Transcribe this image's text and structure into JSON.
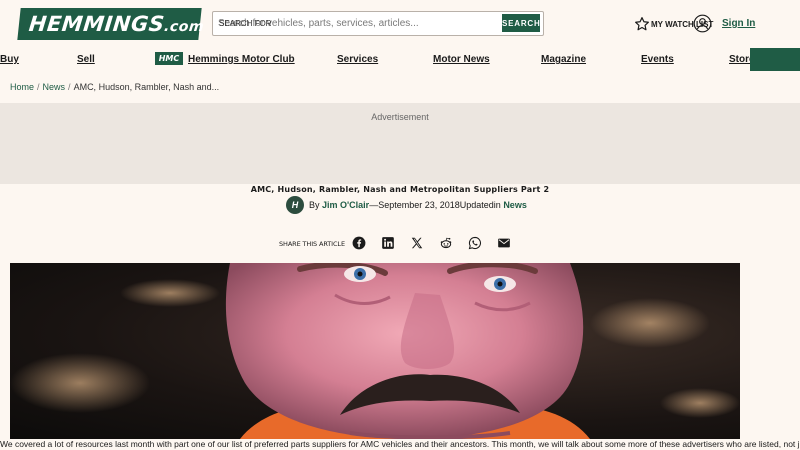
{
  "header": {
    "logo_text": "HEMMINGS",
    "logo_suffix": ".com",
    "search_label": "SEARCH FOR",
    "search_placeholder": "Search for vehicles, parts, services, articles...",
    "search_button": "SEARCH",
    "watchlist_label": "MY WATCH LIST",
    "signin_label": "Sign In"
  },
  "nav": {
    "buy": "Buy",
    "sell": "Sell",
    "hmc_badge": "HMC",
    "motor_club": "Hemmings Motor Club",
    "services": "Services",
    "motor_news": "Motor News",
    "magazine": "Magazine",
    "events": "Events",
    "store": "Store"
  },
  "breadcrumb": {
    "home": "Home",
    "news": "News",
    "current": "AMC, Hudson, Rambler, Nash and..."
  },
  "ad": {
    "label": "Advertisement"
  },
  "article": {
    "title": "AMC, Hudson, Rambler, Nash and Metropolitan Suppliers Part 2",
    "by": "By",
    "author": "Jim O'Clair",
    "date_text": "—September 23, 2018Updatedin",
    "category": "News",
    "share_label": "SHARE THIS ARTICLE",
    "body": "We covered a lot of resources last month with part one of our list of preferred parts suppliers for AMC vehicles and their ancestors. This month, we will talk about some more of these advertisers who are listed, not just in the"
  },
  "colors": {
    "brand_green": "#1f5c45",
    "page_bg": "#fdf7f1",
    "ad_bg": "#ece6e0"
  },
  "icons": [
    "star-icon",
    "user-icon",
    "facebook-icon",
    "linkedin-icon",
    "x-icon",
    "reddit-icon",
    "whatsapp-icon",
    "email-icon"
  ]
}
